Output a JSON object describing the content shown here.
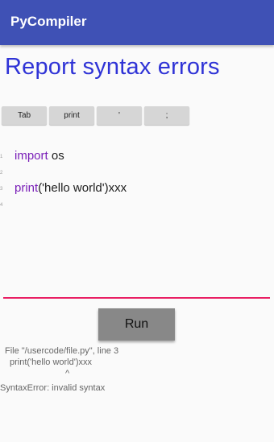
{
  "appbar": {
    "title": "PyCompiler"
  },
  "page": {
    "heading": "Report syntax errors"
  },
  "keybar": {
    "keys": [
      {
        "label": "Tab"
      },
      {
        "label": "print"
      },
      {
        "label": "'"
      },
      {
        "label": ";"
      }
    ]
  },
  "editor": {
    "line_numbers": [
      "1",
      "2",
      "3",
      "4"
    ],
    "line1": {
      "keyword": "import",
      "rest": " os"
    },
    "line3": {
      "keyword": "print",
      "rest": "('hello world')xxx"
    }
  },
  "run_button": {
    "label": "Run"
  },
  "output": {
    "lines": [
      "File \"/usercode/file.py\", line 3",
      "print('hello world')xxx",
      "^",
      "SyntaxError: invalid syntax"
    ]
  },
  "colors": {
    "appbar": "#3f51b5",
    "heading": "#2f33d6",
    "keyword": "#7a1fb8",
    "underline": "#e91e63",
    "run_button": "#888888"
  }
}
